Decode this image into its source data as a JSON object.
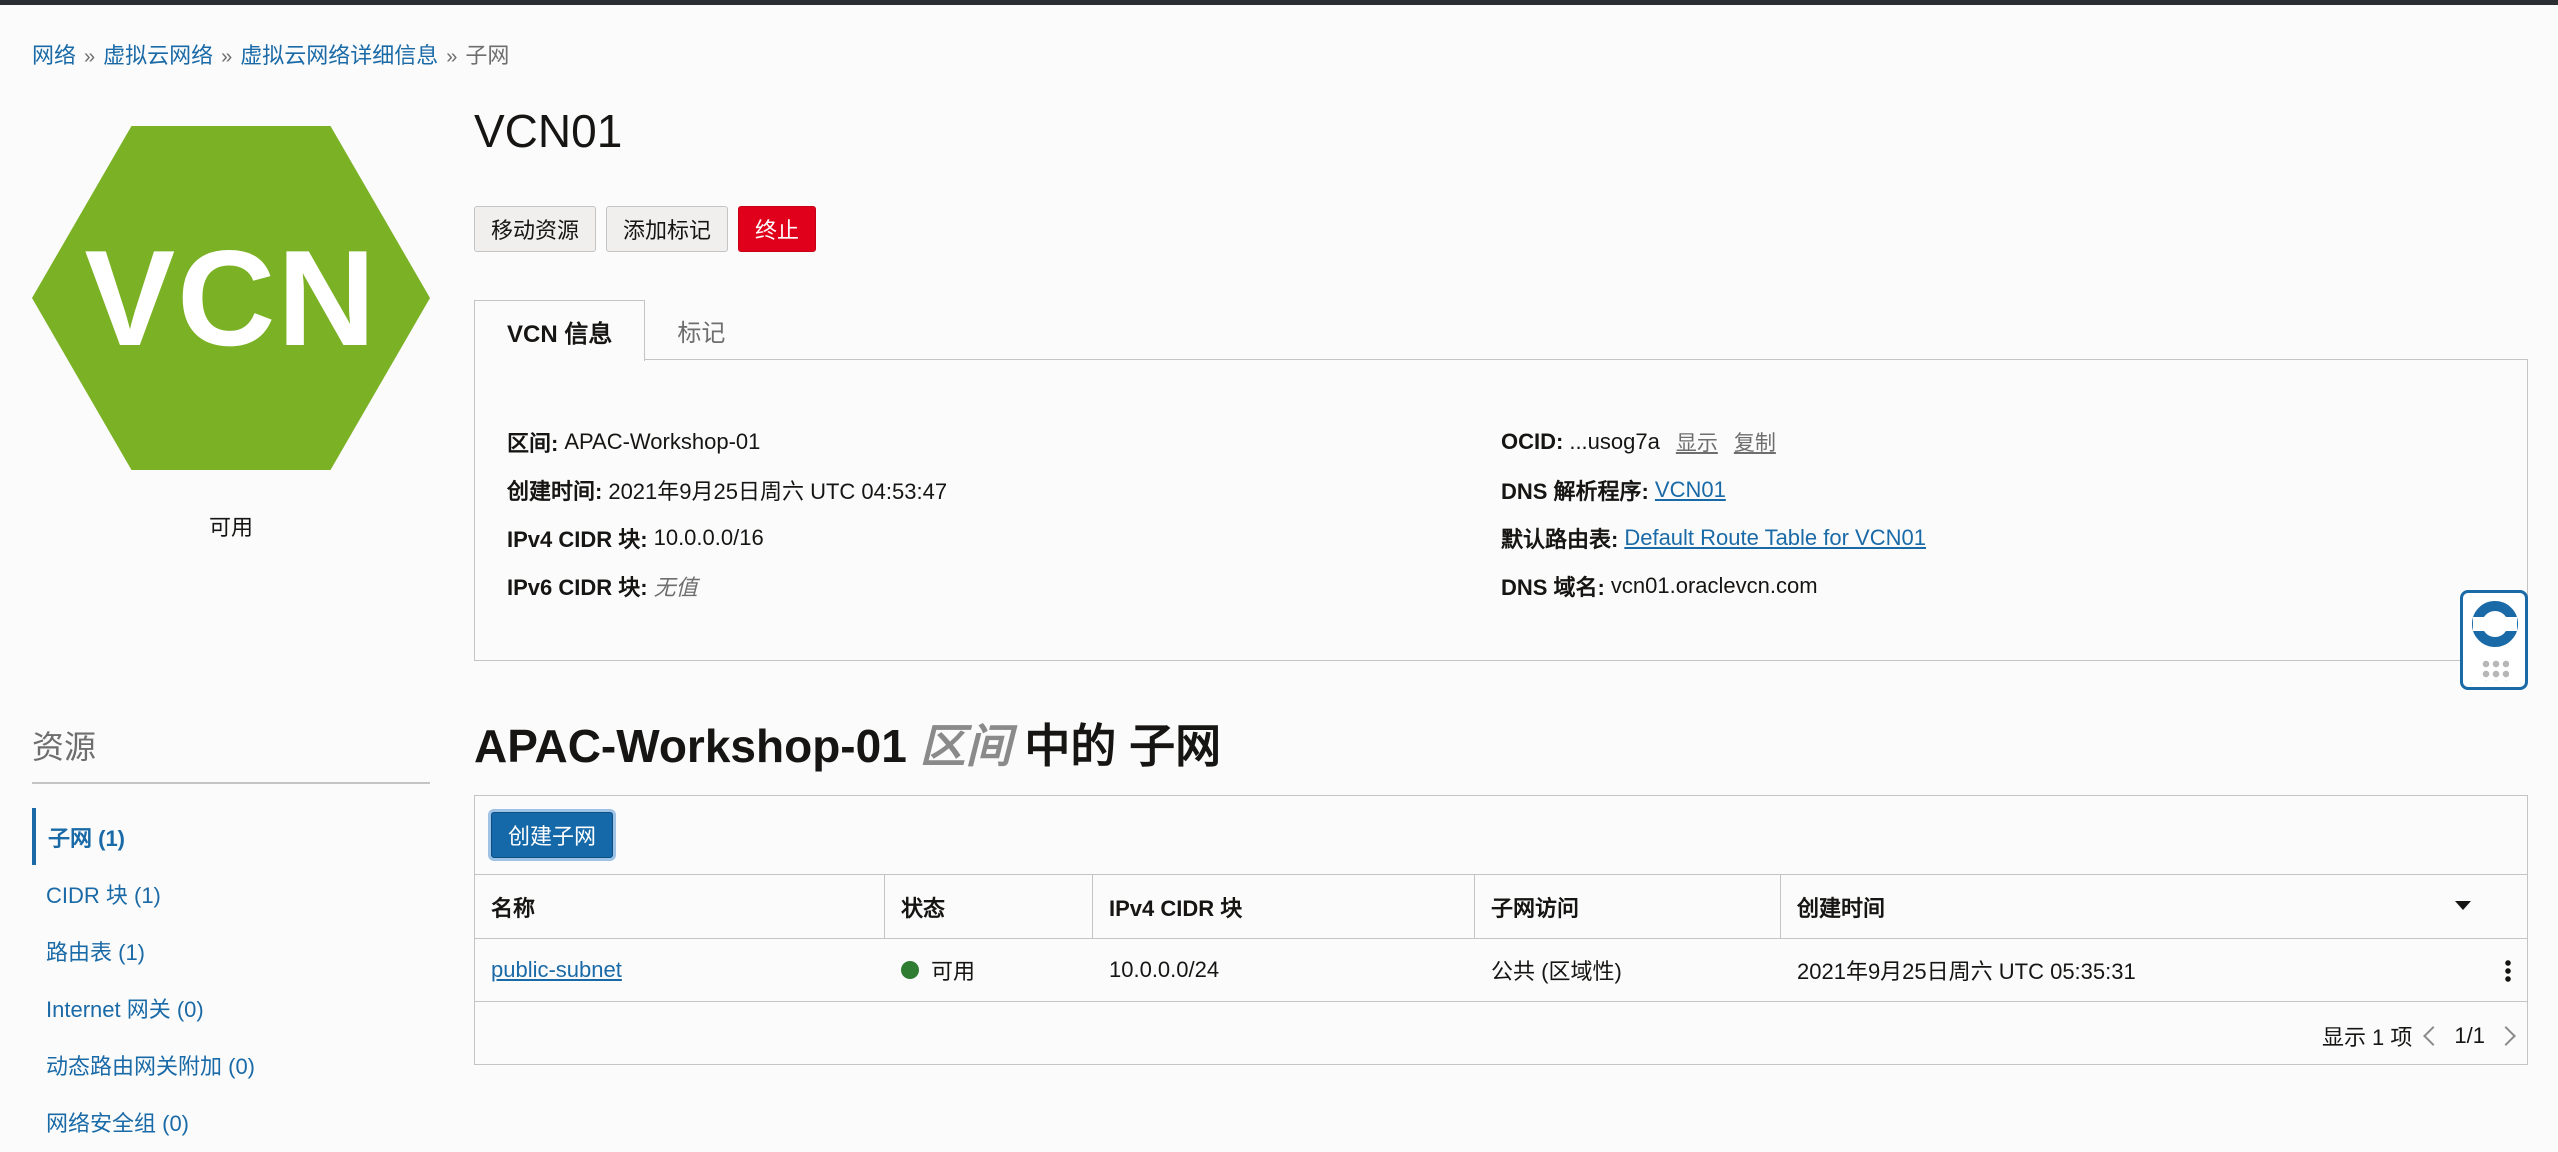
{
  "breadcrumb": {
    "items": [
      "网络",
      "虚拟云网络",
      "虚拟云网络详细信息"
    ],
    "separator": "»",
    "current": "子网"
  },
  "resource_icon": {
    "label": "VCN",
    "color": "#7bb225",
    "status": "可用"
  },
  "title": "VCN01",
  "actions": {
    "move": "移动资源",
    "add_tags": "添加标记",
    "terminate": "终止"
  },
  "tabs": {
    "info": "VCN 信息",
    "tags": "标记"
  },
  "info": {
    "compartment_label": "区间:",
    "compartment_value": "APAC-Workshop-01",
    "created_label": "创建时间:",
    "created_value": "2021年9月25日周六 UTC 04:53:47",
    "ipv4_label": "IPv4 CIDR 块:",
    "ipv4_value": "10.0.0.0/16",
    "ipv6_label": "IPv6 CIDR 块:",
    "ipv6_value": "无值",
    "ocid_label": "OCID:",
    "ocid_value": "...usog7a",
    "ocid_show": "显示",
    "ocid_copy": "复制",
    "dns_resolver_label": "DNS 解析程序:",
    "dns_resolver_value": "VCN01",
    "route_table_label": "默认路由表:",
    "route_table_value": "Default Route Table for VCN01",
    "dns_domain_label": "DNS 域名:",
    "dns_domain_value": "vcn01.oraclevcn.com"
  },
  "resources": {
    "title": "资源",
    "items": [
      "子网 (1)",
      "CIDR 块 (1)",
      "路由表 (1)",
      "Internet 网关 (0)",
      "动态路由网关附加 (0)",
      "网络安全组 (0)"
    ]
  },
  "subnets": {
    "heading_compartment": "APAC-Workshop-01",
    "heading_mid": "区间",
    "heading_suffix": "中的 子网",
    "create_button": "创建子网",
    "columns": [
      "名称",
      "状态",
      "IPv4 CIDR 块",
      "子网访问",
      "创建时间"
    ],
    "rows": [
      {
        "name": "public-subnet",
        "status": "可用",
        "cidr": "10.0.0.0/24",
        "access": "公共 (区域性)",
        "created": "2021年9月25日周六 UTC 05:35:31"
      }
    ],
    "showing": "显示 1 项",
    "page": "1/1"
  },
  "colors": {
    "accent": "#1a6aa7",
    "danger": "#e0001b",
    "available": "#2e7d32"
  }
}
